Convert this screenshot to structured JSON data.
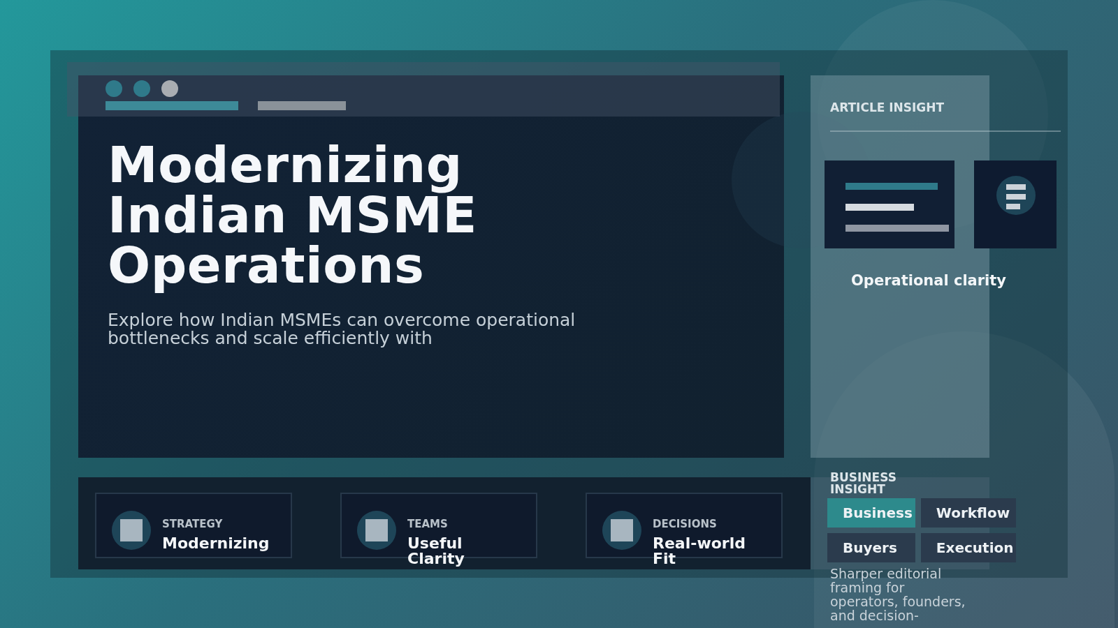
{
  "hero": {
    "title": "Modernizing Indian MSME Operations",
    "subtitle": "Explore how Indian MSMEs can overcome operational bottlenecks and scale efficiently with"
  },
  "insight": {
    "heading": "ARTICLE INSIGHT",
    "caption": "Operational clarity"
  },
  "features": [
    {
      "category": "STRATEGY",
      "title": "Modernizing"
    },
    {
      "category": "TEAMS",
      "title": "Useful Clarity"
    },
    {
      "category": "DECISIONS",
      "title": "Real-world Fit"
    }
  ],
  "business_insight": {
    "heading": "BUSINESS INSIGHT",
    "tags": [
      {
        "label": "Business",
        "selected": true
      },
      {
        "label": "Workflow",
        "selected": false
      },
      {
        "label": "Buyers",
        "selected": false
      },
      {
        "label": "Execution",
        "selected": false
      }
    ],
    "description": "Sharper editorial framing for operators, founders, and decision-"
  }
}
